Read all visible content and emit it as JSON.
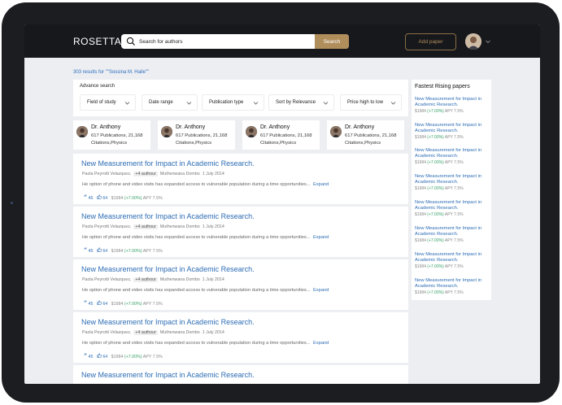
{
  "header": {
    "logo": "ROSETTA",
    "search_placeholder": "Search for authors",
    "search_button": "Search",
    "add_paper": "Add paper"
  },
  "results_count": "303 results for \"\"Sossina M. Haile\"\"",
  "filters": {
    "title": "Advance search",
    "items": [
      "Field of study",
      "Date range",
      "Publication type",
      "Sort by Relevance",
      "Price high to low"
    ]
  },
  "authors": [
    {
      "name": "Dr. Anthony",
      "stats": "617 Publications, 21,168 Citations,Physics"
    },
    {
      "name": "Dr. Anthony",
      "stats": "617 Publications, 21,168 Citations,Physics"
    },
    {
      "name": "Dr. Anthony",
      "stats": "617 Publications, 21,168 Citations,Physics"
    },
    {
      "name": "Dr. Anthony",
      "stats": "617 Publications, 21,168 Citations,Physics"
    }
  ],
  "results": [
    {
      "title": "New Measurement for Impact in Academic Research.",
      "author": "Paola Peyrotti Velazquez,",
      "tag": "+4 authour",
      "coauthor": "Muthenwana Dombo",
      "date": "1 July 2014",
      "desc": "He option of phone and video visits has expanded access to vulnerable population during a time opportunities...",
      "expand": "Expand",
      "quotes": "45",
      "likes": "64",
      "price": "$1984",
      "change": "(+7.00%)",
      "apy": "APY 7.5%"
    },
    {
      "title": "New Measurement for Impact in Academic Research.",
      "author": "Paola Peyrotti Velazquez,",
      "tag": "+4 authour",
      "coauthor": "Muthenwana Dombo",
      "date": "1 July 2014",
      "desc": "He option of phone and video visits has expanded access to vulnerable population during a time opportunities...",
      "expand": "Expand",
      "quotes": "45",
      "likes": "64",
      "price": "$1984",
      "change": "(+7.00%)",
      "apy": "APY 7.5%"
    },
    {
      "title": "New Measurement for Impact in Academic Research.",
      "author": "Paola Peyrotti Velazquez,",
      "tag": "+4 authour",
      "coauthor": "Muthenwana Dombo",
      "date": "1 July 2014",
      "desc": "He option of phone and video visits has expanded access to vulnerable population during a time opportunities...",
      "expand": "Expand",
      "quotes": "45",
      "likes": "64",
      "price": "$1984",
      "change": "(+7.00%)",
      "apy": "APY 7.5%"
    },
    {
      "title": "New Measurement for Impact in Academic Research.",
      "author": "Paola Peyrotti Velazquez,",
      "tag": "+4 authour",
      "coauthor": "Muthenwana Dombo",
      "date": "1 July 2014",
      "desc": "He option of phone and video visits has expanded access to vulnerable population during a time opportunities...",
      "expand": "Expand",
      "quotes": "45",
      "likes": "64",
      "price": "$1984",
      "change": "(+7.00%)",
      "apy": "APY 7.5%"
    },
    {
      "title": "New Measurement for Impact in Academic Research."
    }
  ],
  "rising": {
    "title": "Fastest Rising papers",
    "items": [
      {
        "title": "New Measurement for Impact in Academic Research.",
        "price": "$1984",
        "change": "(+7.00%)",
        "apy": "APY 7.5%"
      },
      {
        "title": "New Measurement for Impact in Academic Research.",
        "price": "$1984",
        "change": "(+7.00%)",
        "apy": "APY 7.5%"
      },
      {
        "title": "New Measurement for Impact in Academic Research.",
        "price": "$1984",
        "change": "(+7.00%)",
        "apy": "APY 7.5%"
      },
      {
        "title": "New Measurement for Impact in Academic Research.",
        "price": "$1984",
        "change": "(+7.00%)",
        "apy": "APY 7.5%"
      },
      {
        "title": "New Measurement for Impact in Academic Research.",
        "price": "$1984",
        "change": "(+7.00%)",
        "apy": "APY 7.5%"
      },
      {
        "title": "New Measurement for Impact in Academic Research.",
        "price": "$1984",
        "change": "(+7.00%)",
        "apy": "APY 7.5%"
      },
      {
        "title": "New Measurement for Impact in Academic Research.",
        "price": "$1984",
        "change": "(+7.00%)",
        "apy": "APY 7.5%"
      },
      {
        "title": "New Measurement for Impact in Academic Research.",
        "price": "$1984",
        "change": "(+7.00%)",
        "apy": "APY 7.5%"
      }
    ]
  },
  "colors": {
    "accent": "#b08e5c",
    "link": "#2d6db5",
    "positive": "#38a169",
    "topbar": "#17181c"
  }
}
